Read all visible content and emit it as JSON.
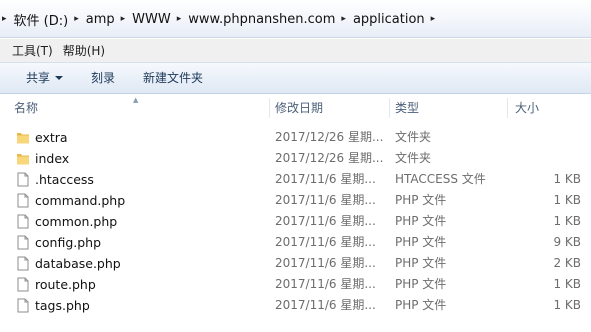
{
  "breadcrumb": [
    "软件 (D:)",
    "amp",
    "WWW",
    "www.phpnanshen.com",
    "application"
  ],
  "menu": {
    "tools": "工具(T)",
    "help": "帮助(H)"
  },
  "toolbar": {
    "share": "共享",
    "burn": "刻录",
    "new_folder": "新建文件夹"
  },
  "columns": {
    "name": "名称",
    "date": "修改日期",
    "type": "类型",
    "size": "大小"
  },
  "files": [
    {
      "name": "extra",
      "date": "2017/12/26 星期...",
      "type": "文件夹",
      "size": "",
      "icon": "folder-icon"
    },
    {
      "name": "index",
      "date": "2017/12/26 星期...",
      "type": "文件夹",
      "size": "",
      "icon": "folder-icon"
    },
    {
      "name": ".htaccess",
      "date": "2017/11/6 星期...",
      "type": "HTACCESS 文件",
      "size": "1 KB",
      "icon": "file-icon"
    },
    {
      "name": "command.php",
      "date": "2017/11/6 星期...",
      "type": "PHP 文件",
      "size": "1 KB",
      "icon": "file-icon"
    },
    {
      "name": "common.php",
      "date": "2017/11/6 星期...",
      "type": "PHP 文件",
      "size": "1 KB",
      "icon": "file-icon"
    },
    {
      "name": "config.php",
      "date": "2017/11/6 星期...",
      "type": "PHP 文件",
      "size": "9 KB",
      "icon": "file-icon"
    },
    {
      "name": "database.php",
      "date": "2017/11/6 星期...",
      "type": "PHP 文件",
      "size": "2 KB",
      "icon": "file-icon"
    },
    {
      "name": "route.php",
      "date": "2017/11/6 星期...",
      "type": "PHP 文件",
      "size": "1 KB",
      "icon": "file-icon"
    },
    {
      "name": "tags.php",
      "date": "2017/11/6 星期...",
      "type": "PHP 文件",
      "size": "1 KB",
      "icon": "file-icon"
    }
  ]
}
